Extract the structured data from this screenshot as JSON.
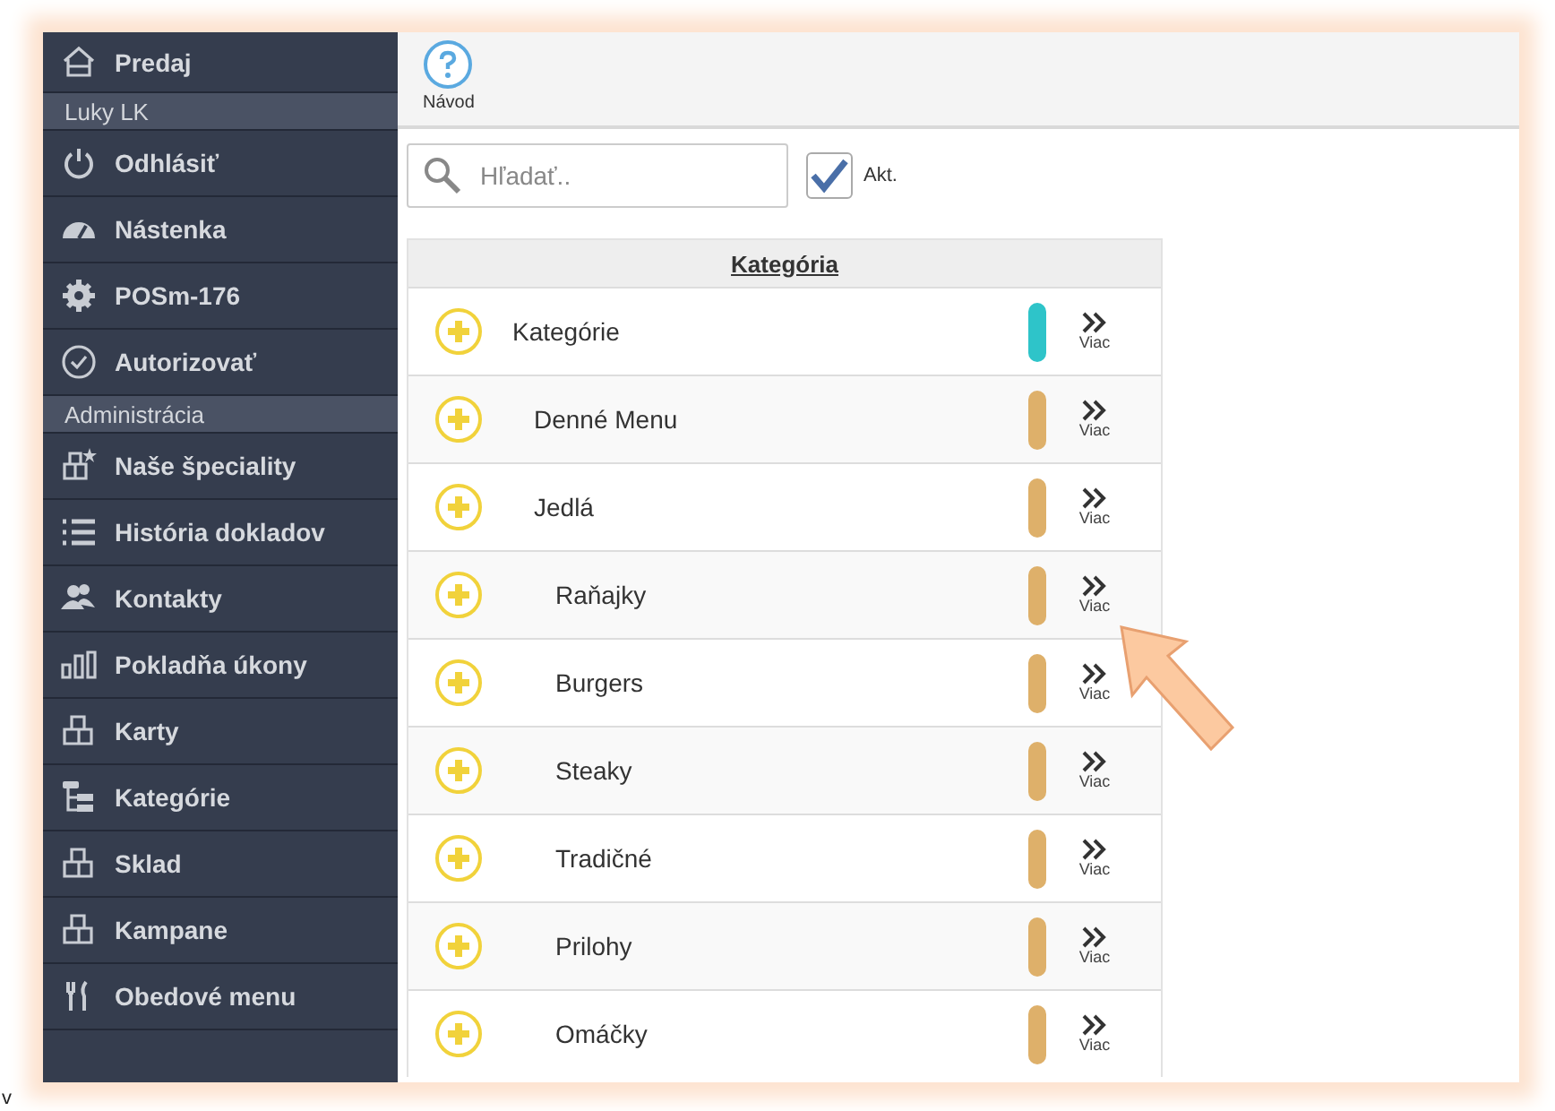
{
  "sidebar": {
    "items": [
      {
        "kind": "item",
        "label": "Predaj"
      },
      {
        "kind": "section",
        "label": "Luky LK"
      },
      {
        "kind": "item",
        "label": "Odhlásiť"
      },
      {
        "kind": "item",
        "label": "Nástenka"
      },
      {
        "kind": "item",
        "label": "POSm-176"
      },
      {
        "kind": "item",
        "label": "Autorizovať"
      },
      {
        "kind": "section",
        "label": "Administrácia"
      },
      {
        "kind": "item",
        "label": "Naše špeciality"
      },
      {
        "kind": "item",
        "label": "História dokladov"
      },
      {
        "kind": "item",
        "label": "Kontakty"
      },
      {
        "kind": "item",
        "label": "Pokladňa úkony"
      },
      {
        "kind": "item",
        "label": "Karty"
      },
      {
        "kind": "item",
        "label": "Kategórie"
      },
      {
        "kind": "item",
        "label": "Sklad"
      },
      {
        "kind": "item",
        "label": "Kampane"
      },
      {
        "kind": "item",
        "label": "Obedové menu"
      }
    ]
  },
  "toolbar": {
    "help_label": "Návod"
  },
  "search": {
    "placeholder": "Hľadať.."
  },
  "active_filter": {
    "label": "Akt.",
    "checked": true
  },
  "table": {
    "column": "Kategória",
    "rows": [
      {
        "name": "Kategórie",
        "color": "#2ec4c9",
        "more_label": "Viac",
        "children": [
          {
            "name": "Denné Menu",
            "color": "#deb06a",
            "more_label": "Viac"
          },
          {
            "name": "Jedlá",
            "color": "#deb06a",
            "more_label": "Viac",
            "children": [
              {
                "name": "Raňajky",
                "color": "#deb06a",
                "more_label": "Viac"
              },
              {
                "name": "Burgers",
                "color": "#deb06a",
                "more_label": "Viac"
              },
              {
                "name": "Steaky",
                "color": "#deb06a",
                "more_label": "Viac"
              },
              {
                "name": "Tradičné",
                "color": "#deb06a",
                "more_label": "Viac"
              },
              {
                "name": "Prilohy",
                "color": "#deb06a",
                "more_label": "Viac"
              },
              {
                "name": "Omáčky",
                "color": "#deb06a",
                "more_label": "Viac"
              }
            ]
          }
        ]
      }
    ]
  },
  "footer_mark": "v"
}
